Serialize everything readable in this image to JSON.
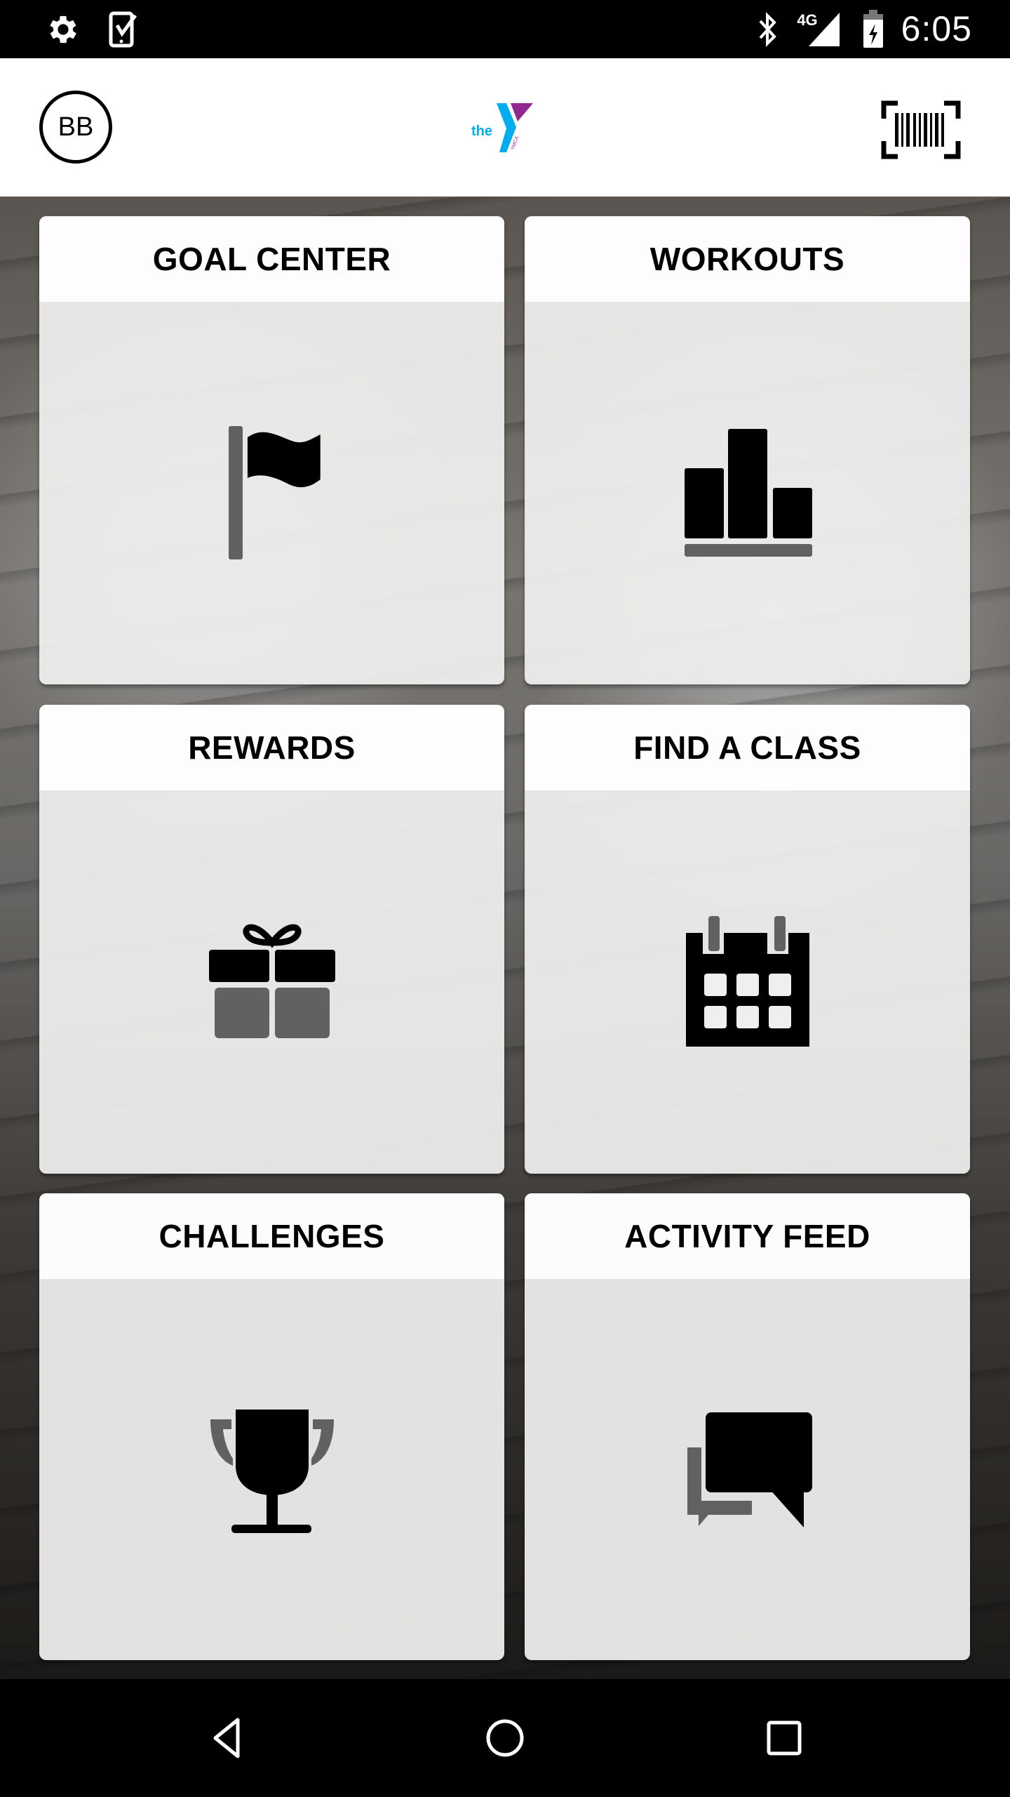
{
  "status_bar": {
    "time": "6:05",
    "network": "4G",
    "left_icons": [
      "settings-icon",
      "phone-check-icon"
    ],
    "right_icons": [
      "bluetooth-icon",
      "cellular-signal-icon",
      "battery-charging-icon"
    ]
  },
  "header": {
    "avatar_initials": "BB",
    "logo_text": "the",
    "logo_subtext": "YMCA",
    "logo_colors": {
      "blue": "#00AEEF",
      "purple": "#92278F"
    },
    "right_icon": "barcode-scan-icon"
  },
  "tiles": [
    {
      "title": "GOAL CENTER",
      "icon": "flag-icon"
    },
    {
      "title": "WORKOUTS",
      "icon": "bar-chart-icon"
    },
    {
      "title": "REWARDS",
      "icon": "gift-icon"
    },
    {
      "title": "FIND A CLASS",
      "icon": "calendar-icon"
    },
    {
      "title": "CHALLENGES",
      "icon": "trophy-icon"
    },
    {
      "title": "ACTIVITY FEED",
      "icon": "chat-bubbles-icon"
    }
  ],
  "nav_bar": {
    "buttons": [
      "back",
      "home",
      "recents"
    ]
  },
  "colors": {
    "icon_primary": "#000000",
    "icon_secondary": "#616161"
  }
}
